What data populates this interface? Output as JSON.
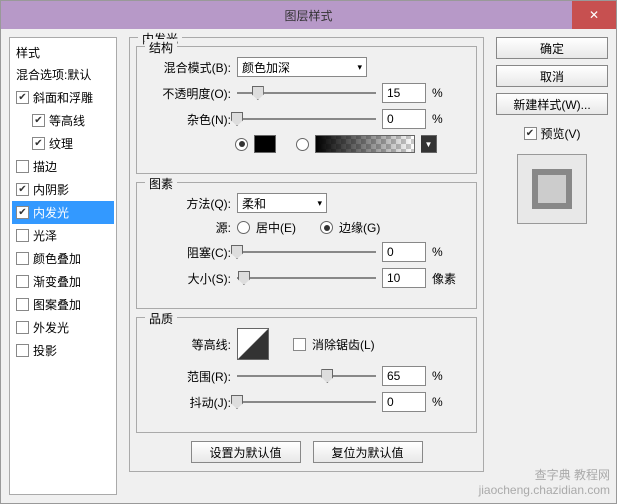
{
  "title": "图层样式",
  "sidebar": {
    "header": "样式",
    "blend_options": "混合选项:默认",
    "items": [
      {
        "label": "斜面和浮雕",
        "checked": true,
        "indent": false
      },
      {
        "label": "等高线",
        "checked": true,
        "indent": true
      },
      {
        "label": "纹理",
        "checked": true,
        "indent": true
      },
      {
        "label": "描边",
        "checked": false,
        "indent": false
      },
      {
        "label": "内阴影",
        "checked": true,
        "indent": false
      },
      {
        "label": "内发光",
        "checked": true,
        "indent": false,
        "selected": true
      },
      {
        "label": "光泽",
        "checked": false,
        "indent": false
      },
      {
        "label": "颜色叠加",
        "checked": false,
        "indent": false
      },
      {
        "label": "渐变叠加",
        "checked": false,
        "indent": false
      },
      {
        "label": "图案叠加",
        "checked": false,
        "indent": false
      },
      {
        "label": "外发光",
        "checked": false,
        "indent": false
      },
      {
        "label": "投影",
        "checked": false,
        "indent": false
      }
    ]
  },
  "main": {
    "panel_title": "内发光",
    "structure": {
      "legend": "结构",
      "blend_mode_label": "混合模式(B):",
      "blend_mode_value": "颜色加深",
      "opacity_label": "不透明度(O):",
      "opacity_value": "15",
      "opacity_unit": "%",
      "noise_label": "杂色(N):",
      "noise_value": "0",
      "noise_unit": "%",
      "color_black": "#000000"
    },
    "elements": {
      "legend": "图素",
      "technique_label": "方法(Q):",
      "technique_value": "柔和",
      "source_label": "源:",
      "source_center": "居中(E)",
      "source_edge": "边缘(G)",
      "choke_label": "阻塞(C):",
      "choke_value": "0",
      "choke_unit": "%",
      "size_label": "大小(S):",
      "size_value": "10",
      "size_unit": "像素"
    },
    "quality": {
      "legend": "品质",
      "contour_label": "等高线:",
      "antialias_label": "消除锯齿(L)",
      "range_label": "范围(R):",
      "range_value": "65",
      "range_unit": "%",
      "jitter_label": "抖动(J):",
      "jitter_value": "0",
      "jitter_unit": "%"
    },
    "buttons": {
      "set_default": "设置为默认值",
      "reset_default": "复位为默认值"
    }
  },
  "right": {
    "ok": "确定",
    "cancel": "取消",
    "new_style": "新建样式(W)...",
    "preview": "预览(V)"
  },
  "watermark": {
    "line1": "查字典 教程网",
    "line2": "jiaocheng.chazidian.com"
  }
}
